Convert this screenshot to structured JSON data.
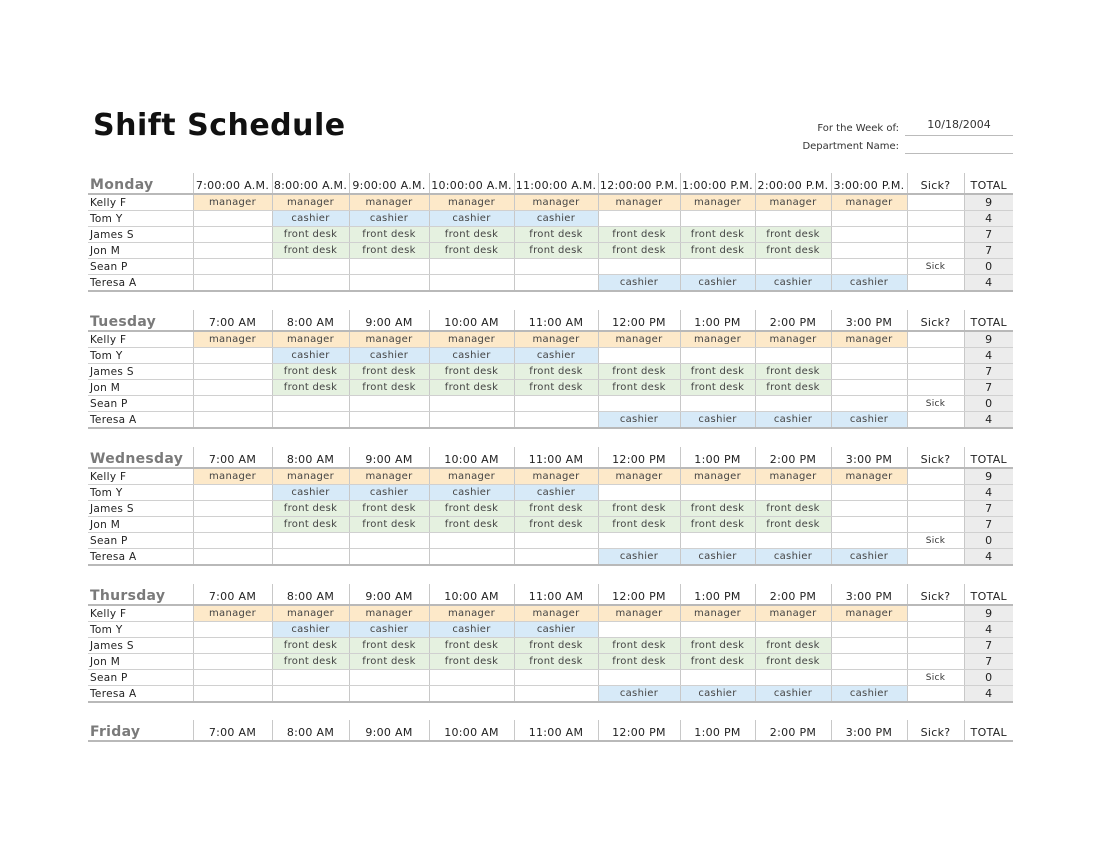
{
  "title": "Shift Schedule",
  "meta": {
    "week_label": "For the Week of:",
    "week_value": "10/18/2004",
    "dept_label": "Department Name:",
    "dept_value": ""
  },
  "colors": {
    "manager": "#fde9c9",
    "cashier": "#d7eaf8",
    "front_desk": "#e5f1e0",
    "total": "#ececec"
  },
  "days": [
    {
      "name": "Monday",
      "times": [
        "7:00:00 A.M.",
        "8:00:00 A.M.",
        "9:00:00 A.M.",
        "10:00:00 A.M.",
        "11:00:00 A.M.",
        "12:00:00 P.M.",
        "1:00:00 P.M.",
        "2:00:00 P.M.",
        "3:00:00 P.M."
      ],
      "sick_header": "Sick?",
      "total_header": "TOTAL",
      "rows": [
        {
          "name": "Kelly F",
          "shifts": [
            "manager",
            "manager",
            "manager",
            "manager",
            "manager",
            "manager",
            "manager",
            "manager",
            "manager"
          ],
          "sick": "",
          "total": "9"
        },
        {
          "name": "Tom Y",
          "shifts": [
            "",
            "cashier",
            "cashier",
            "cashier",
            "cashier",
            "",
            "",
            "",
            ""
          ],
          "sick": "",
          "total": "4"
        },
        {
          "name": "James S",
          "shifts": [
            "",
            "front desk",
            "front desk",
            "front desk",
            "front desk",
            "front desk",
            "front desk",
            "front desk",
            ""
          ],
          "sick": "",
          "total": "7"
        },
        {
          "name": "Jon M",
          "shifts": [
            "",
            "front desk",
            "front desk",
            "front desk",
            "front desk",
            "front desk",
            "front desk",
            "front desk",
            ""
          ],
          "sick": "",
          "total": "7"
        },
        {
          "name": "Sean P",
          "shifts": [
            "",
            "",
            "",
            "",
            "",
            "",
            "",
            "",
            ""
          ],
          "sick": "Sick",
          "total": "0"
        },
        {
          "name": "Teresa A",
          "shifts": [
            "",
            "",
            "",
            "",
            "",
            "cashier",
            "cashier",
            "cashier",
            "cashier"
          ],
          "sick": "",
          "total": "4"
        }
      ]
    },
    {
      "name": "Tuesday",
      "times": [
        "7:00 AM",
        "8:00 AM",
        "9:00 AM",
        "10:00 AM",
        "11:00 AM",
        "12:00 PM",
        "1:00 PM",
        "2:00 PM",
        "3:00 PM"
      ],
      "sick_header": "Sick?",
      "total_header": "TOTAL",
      "rows": [
        {
          "name": "Kelly F",
          "shifts": [
            "manager",
            "manager",
            "manager",
            "manager",
            "manager",
            "manager",
            "manager",
            "manager",
            "manager"
          ],
          "sick": "",
          "total": "9"
        },
        {
          "name": "Tom Y",
          "shifts": [
            "",
            "cashier",
            "cashier",
            "cashier",
            "cashier",
            "",
            "",
            "",
            ""
          ],
          "sick": "",
          "total": "4"
        },
        {
          "name": "James S",
          "shifts": [
            "",
            "front desk",
            "front desk",
            "front desk",
            "front desk",
            "front desk",
            "front desk",
            "front desk",
            ""
          ],
          "sick": "",
          "total": "7"
        },
        {
          "name": "Jon M",
          "shifts": [
            "",
            "front desk",
            "front desk",
            "front desk",
            "front desk",
            "front desk",
            "front desk",
            "front desk",
            ""
          ],
          "sick": "",
          "total": "7"
        },
        {
          "name": "Sean P",
          "shifts": [
            "",
            "",
            "",
            "",
            "",
            "",
            "",
            "",
            ""
          ],
          "sick": "Sick",
          "total": "0"
        },
        {
          "name": "Teresa A",
          "shifts": [
            "",
            "",
            "",
            "",
            "",
            "cashier",
            "cashier",
            "cashier",
            "cashier"
          ],
          "sick": "",
          "total": "4"
        }
      ]
    },
    {
      "name": "Wednesday",
      "times": [
        "7:00 AM",
        "8:00 AM",
        "9:00 AM",
        "10:00 AM",
        "11:00 AM",
        "12:00 PM",
        "1:00 PM",
        "2:00 PM",
        "3:00 PM"
      ],
      "sick_header": "Sick?",
      "total_header": "TOTAL",
      "rows": [
        {
          "name": "Kelly F",
          "shifts": [
            "manager",
            "manager",
            "manager",
            "manager",
            "manager",
            "manager",
            "manager",
            "manager",
            "manager"
          ],
          "sick": "",
          "total": "9"
        },
        {
          "name": "Tom Y",
          "shifts": [
            "",
            "cashier",
            "cashier",
            "cashier",
            "cashier",
            "",
            "",
            "",
            ""
          ],
          "sick": "",
          "total": "4"
        },
        {
          "name": "James S",
          "shifts": [
            "",
            "front desk",
            "front desk",
            "front desk",
            "front desk",
            "front desk",
            "front desk",
            "front desk",
            ""
          ],
          "sick": "",
          "total": "7"
        },
        {
          "name": "Jon M",
          "shifts": [
            "",
            "front desk",
            "front desk",
            "front desk",
            "front desk",
            "front desk",
            "front desk",
            "front desk",
            ""
          ],
          "sick": "",
          "total": "7"
        },
        {
          "name": "Sean P",
          "shifts": [
            "",
            "",
            "",
            "",
            "",
            "",
            "",
            "",
            ""
          ],
          "sick": "Sick",
          "total": "0"
        },
        {
          "name": "Teresa A",
          "shifts": [
            "",
            "",
            "",
            "",
            "",
            "cashier",
            "cashier",
            "cashier",
            "cashier"
          ],
          "sick": "",
          "total": "4"
        }
      ]
    },
    {
      "name": "Thursday",
      "times": [
        "7:00 AM",
        "8:00 AM",
        "9:00 AM",
        "10:00 AM",
        "11:00 AM",
        "12:00 PM",
        "1:00 PM",
        "2:00 PM",
        "3:00 PM"
      ],
      "sick_header": "Sick?",
      "total_header": "TOTAL",
      "rows": [
        {
          "name": "Kelly F",
          "shifts": [
            "manager",
            "manager",
            "manager",
            "manager",
            "manager",
            "manager",
            "manager",
            "manager",
            "manager"
          ],
          "sick": "",
          "total": "9"
        },
        {
          "name": "Tom Y",
          "shifts": [
            "",
            "cashier",
            "cashier",
            "cashier",
            "cashier",
            "",
            "",
            "",
            ""
          ],
          "sick": "",
          "total": "4"
        },
        {
          "name": "James S",
          "shifts": [
            "",
            "front desk",
            "front desk",
            "front desk",
            "front desk",
            "front desk",
            "front desk",
            "front desk",
            ""
          ],
          "sick": "",
          "total": "7"
        },
        {
          "name": "Jon M",
          "shifts": [
            "",
            "front desk",
            "front desk",
            "front desk",
            "front desk",
            "front desk",
            "front desk",
            "front desk",
            ""
          ],
          "sick": "",
          "total": "7"
        },
        {
          "name": "Sean P",
          "shifts": [
            "",
            "",
            "",
            "",
            "",
            "",
            "",
            "",
            ""
          ],
          "sick": "Sick",
          "total": "0"
        },
        {
          "name": "Teresa A",
          "shifts": [
            "",
            "",
            "",
            "",
            "",
            "cashier",
            "cashier",
            "cashier",
            "cashier"
          ],
          "sick": "",
          "total": "4"
        }
      ]
    },
    {
      "name": "Friday",
      "times": [
        "7:00 AM",
        "8:00 AM",
        "9:00 AM",
        "10:00 AM",
        "11:00 AM",
        "12:00 PM",
        "1:00 PM",
        "2:00 PM",
        "3:00 PM"
      ],
      "sick_header": "Sick?",
      "total_header": "TOTAL",
      "rows": []
    }
  ]
}
